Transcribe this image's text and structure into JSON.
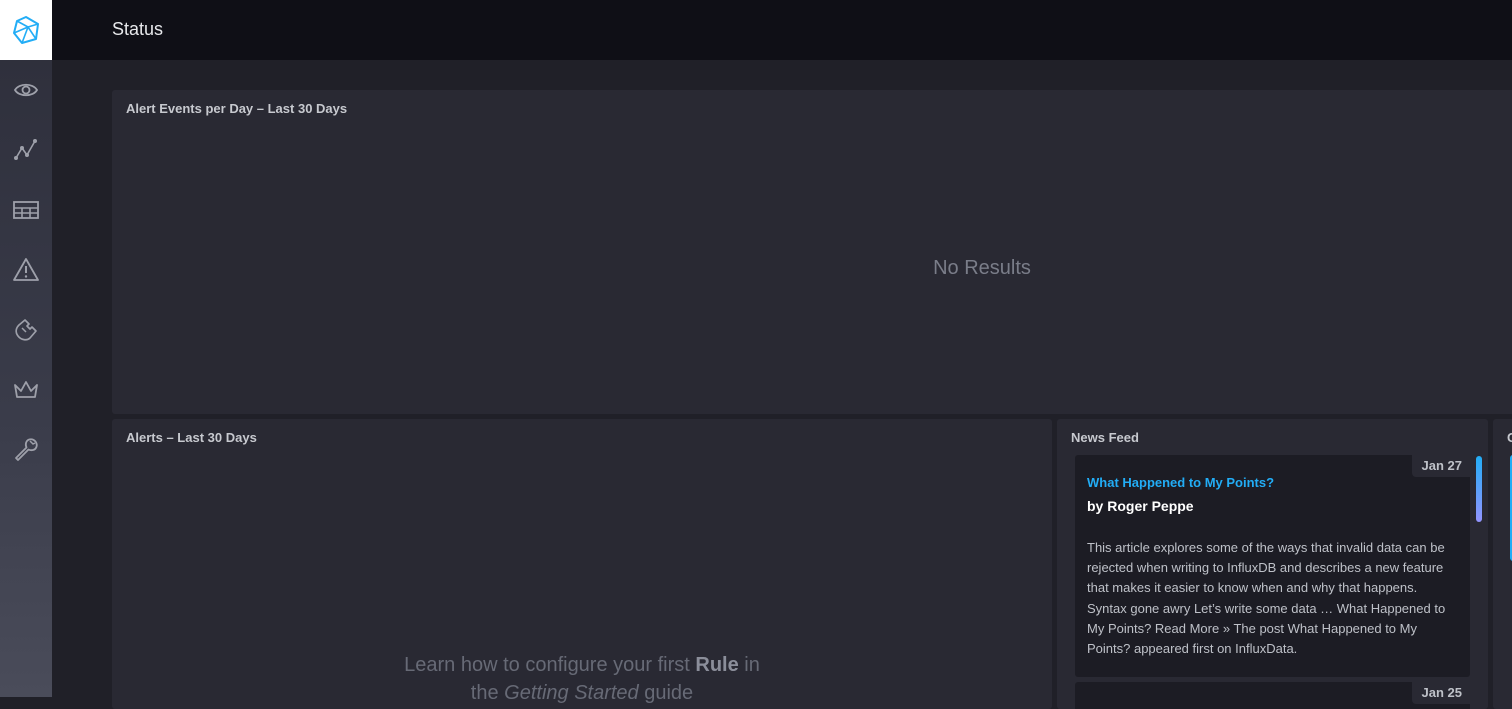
{
  "header": {
    "title": "Status"
  },
  "sidebar": {
    "items": [
      {
        "icon": "eye-icon"
      },
      {
        "icon": "graph-icon"
      },
      {
        "icon": "table-icon"
      },
      {
        "icon": "alert-triangle-icon"
      },
      {
        "icon": "puzzle-icon"
      },
      {
        "icon": "crown-icon"
      },
      {
        "icon": "wrench-icon"
      }
    ]
  },
  "alert_events_panel": {
    "title": "Alert Events per Day – Last 30 Days",
    "empty_text": "No Results"
  },
  "alerts_panel": {
    "title": "Alerts – Last 30 Days",
    "msg_prefix": "Learn how to configure your first ",
    "msg_bold": "Rule",
    "msg_middle": " in",
    "msg_line2_pre": "the ",
    "msg_italic": "Getting Started",
    "msg_line2_post": " guide"
  },
  "news_feed": {
    "title": "News Feed",
    "items": [
      {
        "date": "Jan 27",
        "title": "What Happened to My Points?",
        "author": "by Roger Peppe",
        "body": "This article explores some of the ways that invalid data can be rejected when writing to InfluxDB and describes a new feature that makes it easier to know when and why that happens. Syntax gone awry Let’s write some data … What Happened to My Points? Read More » The post What Happened to My Points? appeared first on InfluxData."
      },
      {
        "date": "Jan 25"
      }
    ]
  },
  "getting_started": {
    "title": "G"
  },
  "colors": {
    "accent": "#22adf6",
    "logo": "#22adf6",
    "background": "#202028",
    "panel": "#292933"
  }
}
